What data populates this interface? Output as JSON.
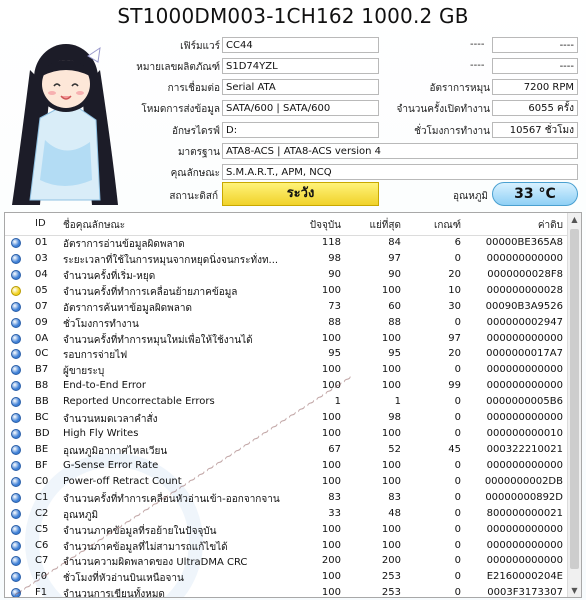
{
  "title": "ST1000DM003-1CH162 1000.2 GB",
  "info": {
    "firmware": {
      "label": "เฟิร์มแวร์",
      "value": "CC44"
    },
    "serial": {
      "label": "หมายเลขผลิตภัณฑ์",
      "value": "S1D74YZL"
    },
    "interface": {
      "label": "การเชื่อมต่อ",
      "value": "Serial ATA"
    },
    "transfer_mode": {
      "label": "โหมดการส่งข้อมูล",
      "value": "SATA/600 | SATA/600"
    },
    "drive_letter": {
      "label": "อักษรไดรฟ์",
      "value": "D:"
    },
    "standard": {
      "label": "มาตรฐาน",
      "value": "ATA8-ACS | ATA8-ACS version 4"
    },
    "features": {
      "label": "คุณลักษณะ",
      "value": "S.M.A.R.T., APM, NCQ"
    },
    "right_top_1": "----",
    "right_top_2": "----",
    "right_top_1b": "----",
    "right_top_2b": "----",
    "rotation_rate": {
      "label": "อัตราการหมุน",
      "value": "7200 RPM"
    },
    "power_on_count": {
      "label": "จำนวนครั้งเปิดทำงาน",
      "value": "6055 ครั้ง"
    },
    "power_on_hours": {
      "label": "ชั่วโมงการทำงาน",
      "value": "10567 ชั่วโมง"
    }
  },
  "status": {
    "label": "สถานะดิสก์",
    "value": "ระวัง",
    "color": "#f5dc3a"
  },
  "temperature": {
    "label": "อุณหภูมิ",
    "value": "33 °C"
  },
  "table": {
    "headers": {
      "id": "ID",
      "name": "ชื่อคุณลักษณะ",
      "current": "ปัจจุบัน",
      "worst": "แย่ที่สุด",
      "threshold": "เกณฑ์",
      "raw": "ค่าดิบ"
    },
    "rows": [
      {
        "id": "01",
        "name": "อัตราการอ่านข้อมูลผิดพลาด",
        "current": "118",
        "worst": "84",
        "threshold": "6",
        "raw": "00000BE365A8",
        "status": "good"
      },
      {
        "id": "03",
        "name": "ระยะเวลาที่ใช้ในการหมุนจากหยุดนิ่งจนกระทั่งท...",
        "current": "98",
        "worst": "97",
        "threshold": "0",
        "raw": "000000000000",
        "status": "good"
      },
      {
        "id": "04",
        "name": "จำนวนครั้งที่เริ่ม-หยุด",
        "current": "90",
        "worst": "90",
        "threshold": "20",
        "raw": "0000000028F8",
        "status": "good"
      },
      {
        "id": "05",
        "name": "จำนวนครั้งที่ทำการเคลื่อนย้ายภาคข้อมูล",
        "current": "100",
        "worst": "100",
        "threshold": "10",
        "raw": "000000000028",
        "status": "caution"
      },
      {
        "id": "07",
        "name": "อัตราการค้นหาข้อมูลผิดพลาด",
        "current": "73",
        "worst": "60",
        "threshold": "30",
        "raw": "00090B3A9526",
        "status": "good"
      },
      {
        "id": "09",
        "name": "ชั่วโมงการทำงาน",
        "current": "88",
        "worst": "88",
        "threshold": "0",
        "raw": "000000002947",
        "status": "good"
      },
      {
        "id": "0A",
        "name": "จำนวนครั้งที่ทำการหมุนใหม่เพื่อให้ใช้งานได้",
        "current": "100",
        "worst": "100",
        "threshold": "97",
        "raw": "000000000000",
        "status": "good"
      },
      {
        "id": "0C",
        "name": "รอบการจ่ายไฟ",
        "current": "95",
        "worst": "95",
        "threshold": "20",
        "raw": "0000000017A7",
        "status": "good"
      },
      {
        "id": "B7",
        "name": "ผู้ขายระบุ",
        "current": "100",
        "worst": "100",
        "threshold": "0",
        "raw": "000000000000",
        "status": "good"
      },
      {
        "id": "B8",
        "name": "End-to-End Error",
        "current": "100",
        "worst": "100",
        "threshold": "99",
        "raw": "000000000000",
        "status": "good"
      },
      {
        "id": "BB",
        "name": "Reported Uncorrectable Errors",
        "current": "1",
        "worst": "1",
        "threshold": "0",
        "raw": "0000000005B6",
        "status": "good"
      },
      {
        "id": "BC",
        "name": "จำนวนหมดเวลาคำสั่ง",
        "current": "100",
        "worst": "98",
        "threshold": "0",
        "raw": "000000000000",
        "status": "good"
      },
      {
        "id": "BD",
        "name": "High Fly Writes",
        "current": "100",
        "worst": "100",
        "threshold": "0",
        "raw": "000000000010",
        "status": "good"
      },
      {
        "id": "BE",
        "name": "อุณหภูมิอากาศไหลเวียน",
        "current": "67",
        "worst": "52",
        "threshold": "45",
        "raw": "000322210021",
        "status": "good"
      },
      {
        "id": "BF",
        "name": "G-Sense Error Rate",
        "current": "100",
        "worst": "100",
        "threshold": "0",
        "raw": "000000000000",
        "status": "good"
      },
      {
        "id": "C0",
        "name": "Power-off Retract Count",
        "current": "100",
        "worst": "100",
        "threshold": "0",
        "raw": "0000000002DB",
        "status": "good"
      },
      {
        "id": "C1",
        "name": "จำนวนครั้งที่ทำการเคลื่อนหัวอ่านเข้า-ออกจากจาน",
        "current": "83",
        "worst": "83",
        "threshold": "0",
        "raw": "00000000892D",
        "status": "good"
      },
      {
        "id": "C2",
        "name": "อุณหภูมิ",
        "current": "33",
        "worst": "48",
        "threshold": "0",
        "raw": "800000000021",
        "status": "good"
      },
      {
        "id": "C5",
        "name": "จำนวนภาคข้อมูลที่รอย้ายในปัจจุบัน",
        "current": "100",
        "worst": "100",
        "threshold": "0",
        "raw": "000000000000",
        "status": "good"
      },
      {
        "id": "C6",
        "name": "จำนวนภาคข้อมูลที่ไม่สามารถแก้ไขได้",
        "current": "100",
        "worst": "100",
        "threshold": "0",
        "raw": "000000000000",
        "status": "good"
      },
      {
        "id": "C7",
        "name": "จำนวนความผิดพลาดของ UltraDMA CRC",
        "current": "200",
        "worst": "200",
        "threshold": "0",
        "raw": "000000000000",
        "status": "good"
      },
      {
        "id": "F0",
        "name": "ชั่วโมงที่หัวอ่านบินเหนือจาน",
        "current": "100",
        "worst": "253",
        "threshold": "0",
        "raw": "E2160000204E",
        "status": "good"
      },
      {
        "id": "F1",
        "name": "จำนวนการเขียนทั้งหมด",
        "current": "100",
        "worst": "253",
        "threshold": "0",
        "raw": "0003F3173307",
        "status": "good"
      }
    ]
  },
  "colors": {
    "good": "#3d7fd6",
    "caution": "#f2d21f"
  }
}
